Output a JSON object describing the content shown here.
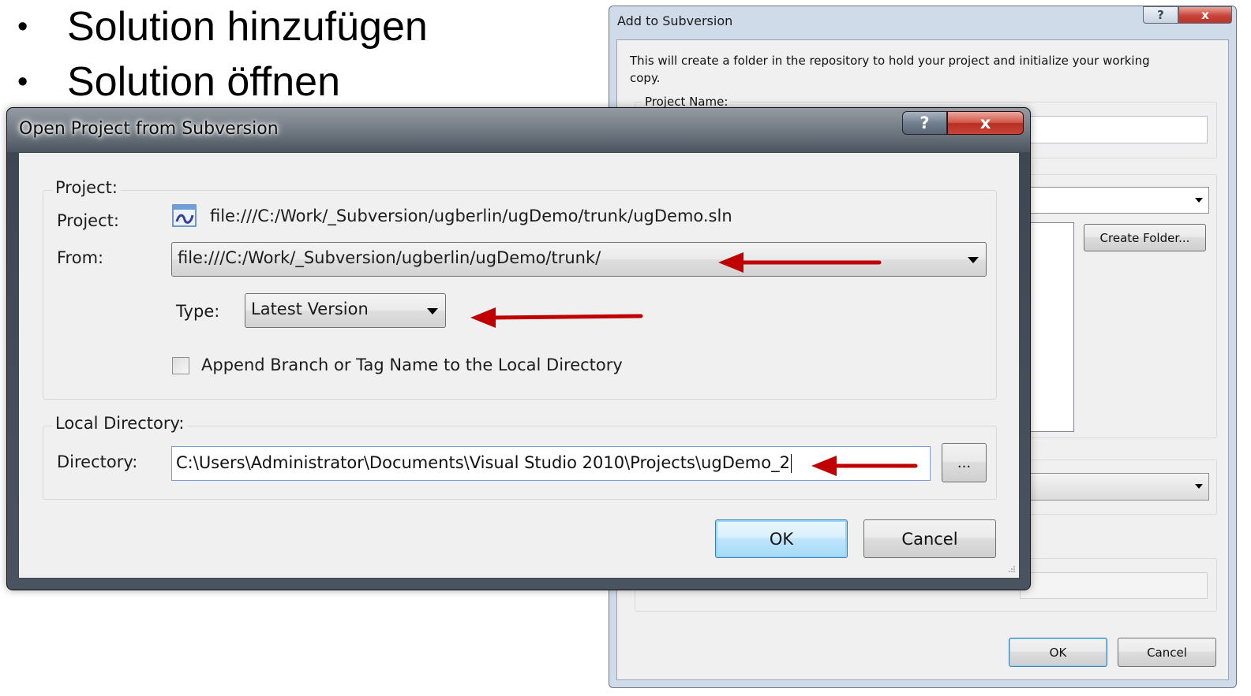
{
  "slide": {
    "bullets": [
      {
        "marker": "•",
        "text": "Solution hinzufügen"
      },
      {
        "marker": "•",
        "text": "Solution öffnen"
      }
    ]
  },
  "back_dialog": {
    "title": "Add to Subversion",
    "help_glyph": "?",
    "close_glyph": "x",
    "description": "This will create a folder in the repository to hold your project and initialize your working copy.",
    "project_name_label": "Project Name:",
    "create_folder_label": "Create Folder...",
    "ok_label": "OK",
    "cancel_label": "Cancel"
  },
  "dialog": {
    "title": "Open Project from Subversion",
    "help_glyph": "?",
    "close_glyph": "x",
    "project_group_label": "Project:",
    "project_label": "Project:",
    "project_value": "file:///C:/Work/_Subversion/ugberlin/ugDemo/trunk/ugDemo.sln",
    "from_label": "From:",
    "from_value": "file:///C:/Work/_Subversion/ugberlin/ugDemo/trunk/",
    "type_label": "Type:",
    "type_value": "Latest Version",
    "append_label": "Append Branch or Tag Name to the Local Directory",
    "append_checked": false,
    "local_group_label": "Local Directory:",
    "directory_label": "Directory:",
    "directory_value": "C:\\Users\\Administrator\\Documents\\Visual Studio 2010\\Projects\\ugDemo_2",
    "browse_label": "...",
    "ok_label": "OK",
    "cancel_label": "Cancel"
  },
  "colors": {
    "annotation_arrow": "#c00000",
    "close_button": "#c8433a"
  },
  "icons": [
    "bullet-marker",
    "solution-file-icon",
    "help-icon",
    "close-icon",
    "dropdown-arrow-icon",
    "annotation-arrow",
    "size-grip-icon"
  ]
}
